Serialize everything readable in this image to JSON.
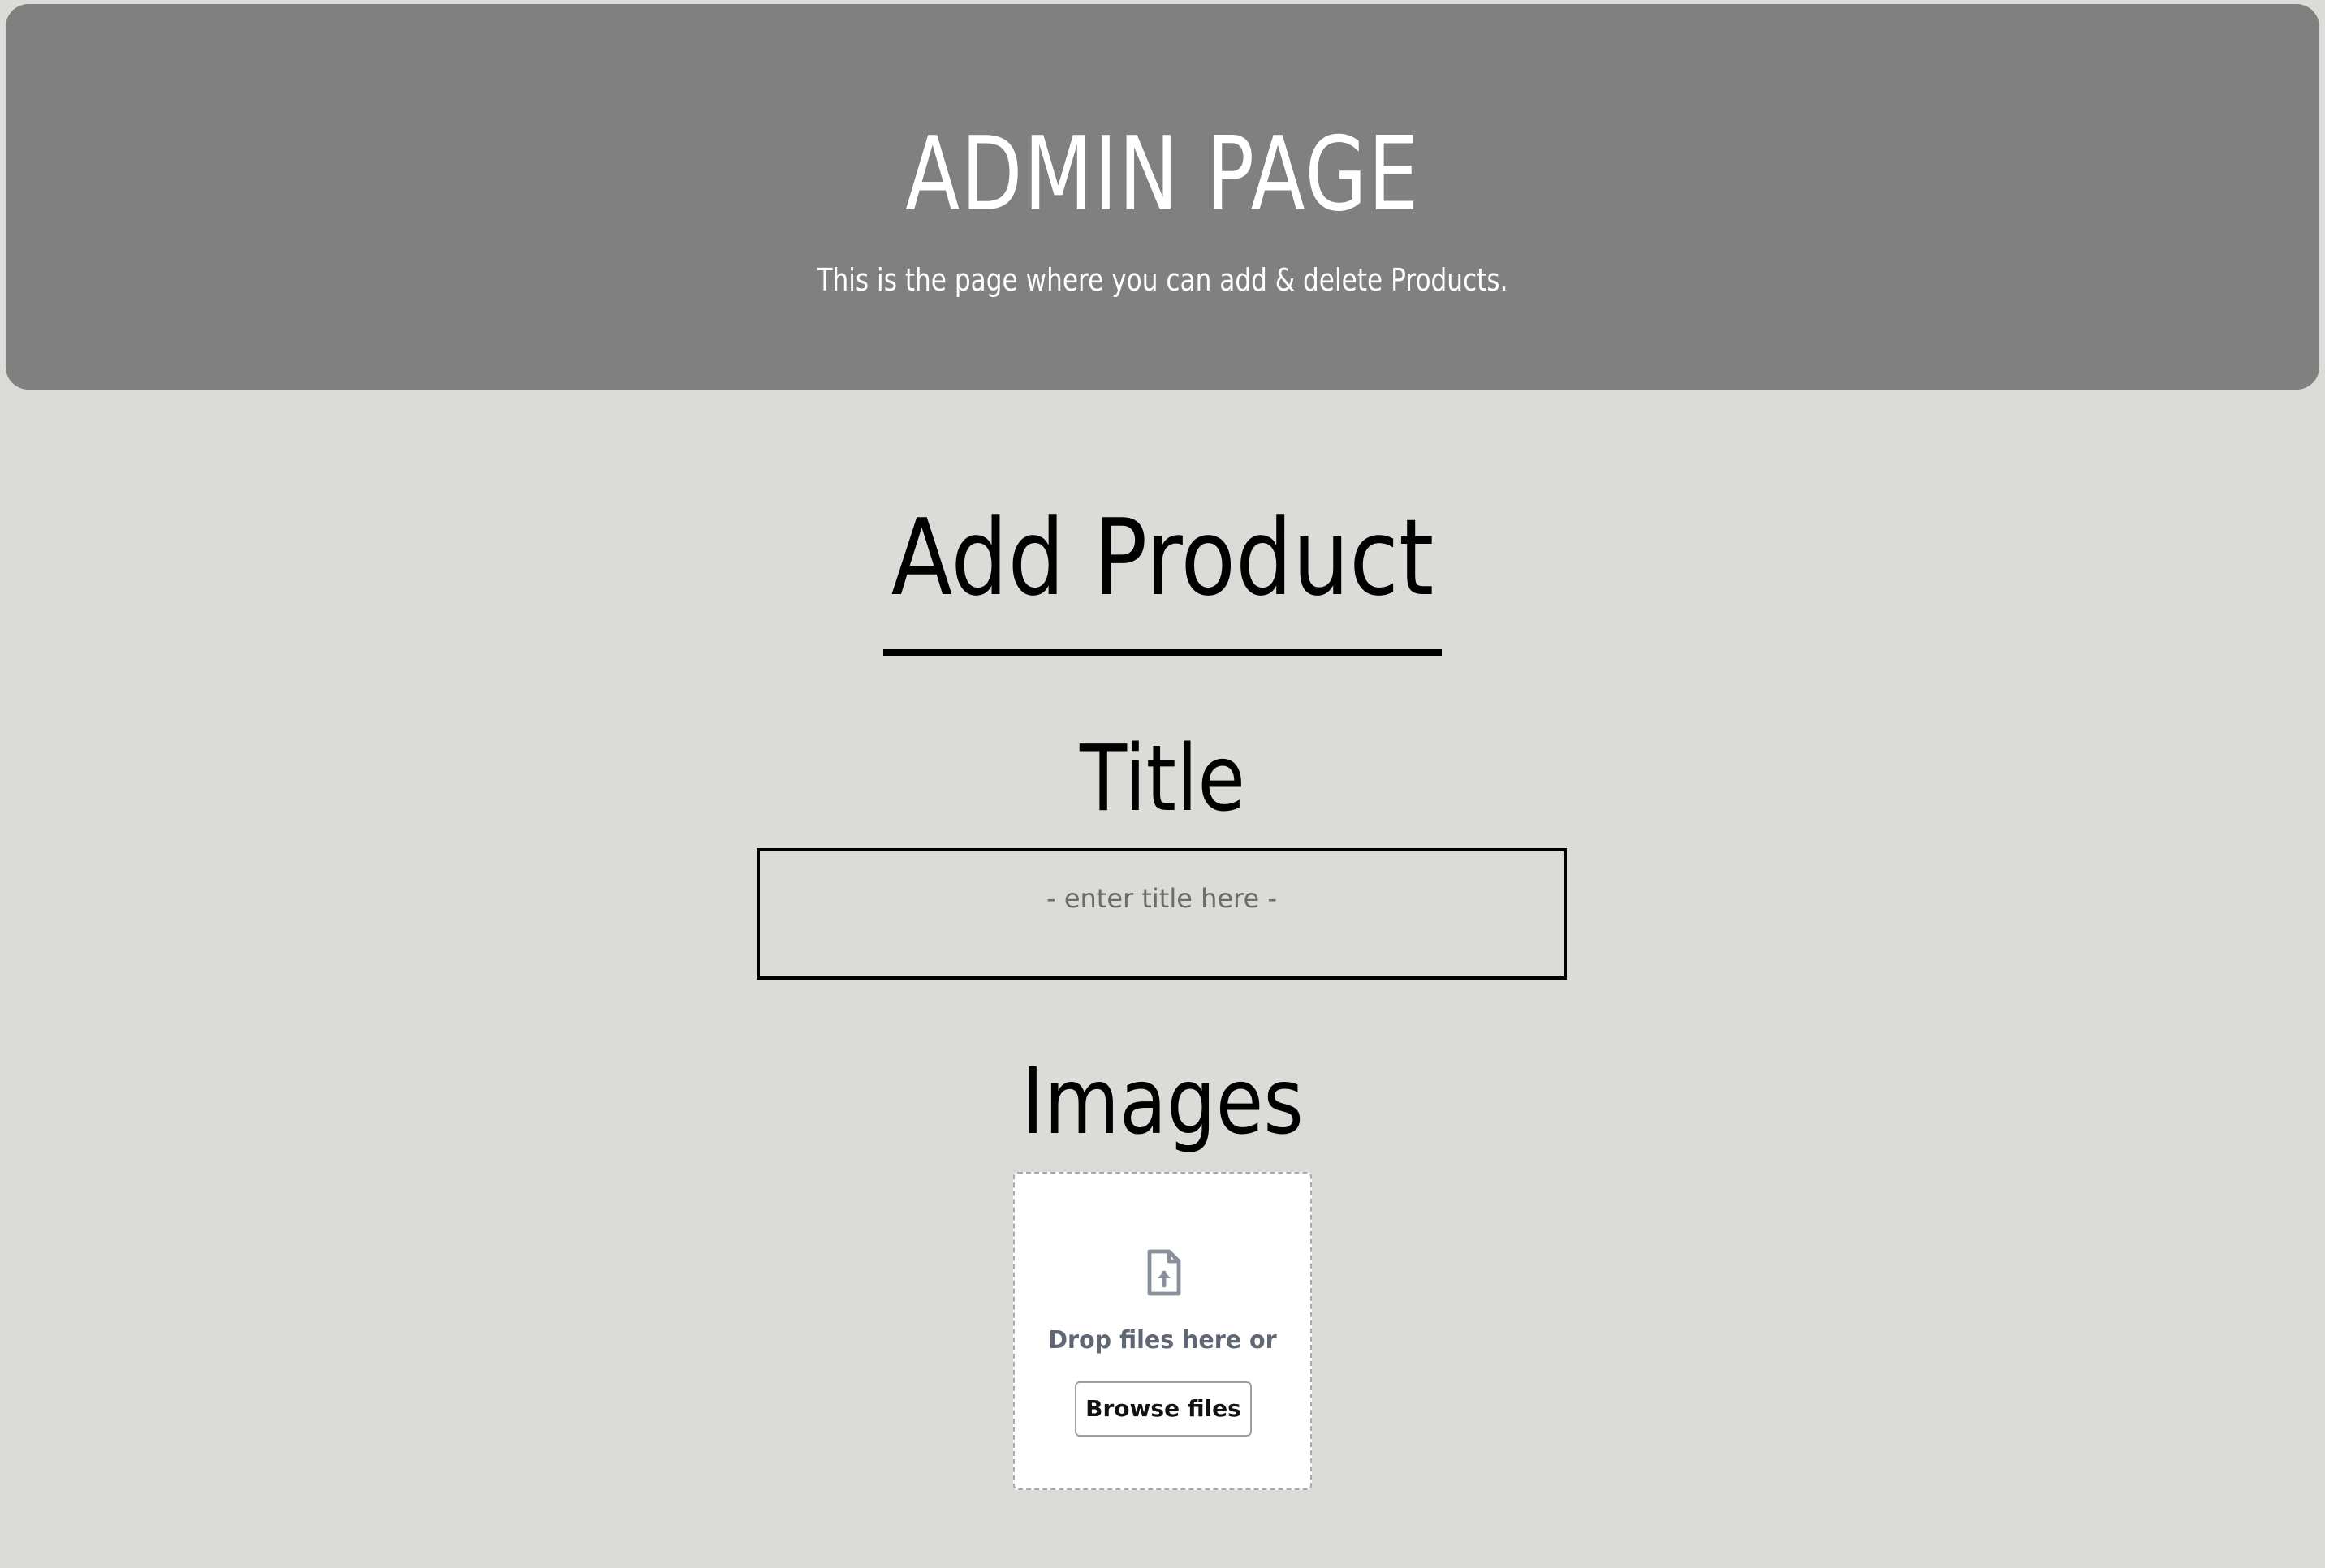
{
  "header": {
    "title": "ADMIN PAGE",
    "subtitle": "This is the page where you can add & delete Products.",
    "background_color": "#808080"
  },
  "form": {
    "heading": "Add Product",
    "title_label": "Title",
    "title_placeholder": "- enter title here -",
    "images_label": "Images"
  },
  "uploader": {
    "icon": "file-upload-icon",
    "drop_text": "Drop files here or",
    "browse_label": "Browse files"
  },
  "colors": {
    "page_background": "#dbdcd7",
    "header_background": "#808080",
    "icon_color": "#8a909b"
  }
}
